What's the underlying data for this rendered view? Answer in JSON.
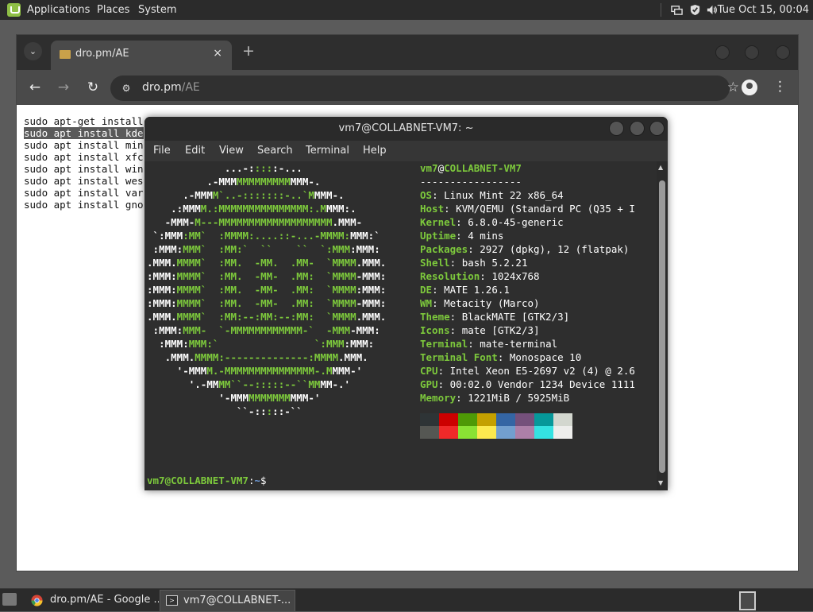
{
  "top_panel": {
    "menus": [
      "Applications",
      "Places",
      "System"
    ],
    "clock": "Tue Oct 15, 00:04",
    "tray_icons": [
      "network-icon",
      "shield-icon",
      "volume-icon"
    ]
  },
  "browser": {
    "tab": {
      "title": "dro.pm/AE",
      "close": "×",
      "new_tab": "+"
    },
    "url": {
      "host": "dro.pm",
      "path": "/AE"
    },
    "page_lines": [
      "sudo apt-get install",
      "sudo apt install kde",
      "sudo apt install min",
      "sudo apt install xfc",
      "sudo apt install win",
      "sudo apt install wes",
      "sudo apt install var",
      "sudo apt install gno"
    ],
    "highlighted_line_index": 1
  },
  "terminal": {
    "title": "vm7@COLLABNET-VM7: ~",
    "menu": [
      "File",
      "Edit",
      "View",
      "Search",
      "Terminal",
      "Help"
    ],
    "logo": [
      "             ...-:::::-...",
      "          .-MMMMMMMMMMMMMMM-.",
      "      .-MMMM`..-:::::::-..`MMMM-.",
      "    .:MMMM.:MMMMMMMMMMMMMMM:.MMMM:.",
      "   -MMM-M---MMMMMMMMMMMMMMMMMMM.MMM-",
      " `:MMM:MM`  :MMMM:....::-...-MMMM:MMM:`",
      " :MMM:MMM`  :MM:`  ``    ``  `:MMM:MMM:",
      ".MMM.MMMM`  :MM.  -MM.  .MM-  `MMMM.MMM.",
      ":MMM:MMMM`  :MM.  -MM-  .MM:  `MMMM-MMM:",
      ":MMM:MMMM`  :MM.  -MM-  .MM:  `MMMM:MMM:",
      ":MMM:MMMM`  :MM.  -MM-  .MM:  `MMMM-MMM:",
      ".MMM.MMMM`  :MM:--:MM:--:MM:  `MMMM.MMM.",
      " :MMM:MMM-  `-MMMMMMMMMMMM-`  -MMM-MMM:",
      "  :MMM:MMM:`                `:MMM:MMM:",
      "   .MMM.MMMM:--------------:MMMM.MMM.",
      "     '-MMMM.-MMMMMMMMMMMMMMM-.MMMM-'",
      "       '.-MMMM``--:::::--``MMMM-.'",
      "            '-MMMMMMMMMMMMM-'",
      "               ``-:::::-``"
    ],
    "header": {
      "user": "vm7",
      "at": "@",
      "host": "COLLABNET-VM7",
      "separator": "-----------------"
    },
    "info": [
      {
        "key": "OS",
        "value": "Linux Mint 22 x86_64"
      },
      {
        "key": "Host",
        "value": "KVM/QEMU (Standard PC (Q35 + I"
      },
      {
        "key": "Kernel",
        "value": "6.8.0-45-generic"
      },
      {
        "key": "Uptime",
        "value": "4 mins"
      },
      {
        "key": "Packages",
        "value": "2927 (dpkg), 12 (flatpak)"
      },
      {
        "key": "Shell",
        "value": "bash 5.2.21"
      },
      {
        "key": "Resolution",
        "value": "1024x768"
      },
      {
        "key": "DE",
        "value": "MATE 1.26.1"
      },
      {
        "key": "WM",
        "value": "Metacity (Marco)"
      },
      {
        "key": "Theme",
        "value": "BlackMATE [GTK2/3]"
      },
      {
        "key": "Icons",
        "value": "mate [GTK2/3]"
      },
      {
        "key": "Terminal",
        "value": "mate-terminal"
      },
      {
        "key": "Terminal Font",
        "value": "Monospace 10"
      },
      {
        "key": "CPU",
        "value": "Intel Xeon E5-2697 v2 (4) @ 2.6"
      },
      {
        "key": "GPU",
        "value": "00:02.0 Vendor 1234 Device 1111"
      },
      {
        "key": "Memory",
        "value": "1221MiB / 5925MiB"
      }
    ],
    "palette_top": [
      "#2e3436",
      "#cc0000",
      "#4e9a06",
      "#c4a000",
      "#3465a4",
      "#75507b",
      "#06989a",
      "#d3d7cf"
    ],
    "palette_bottom": [
      "#555753",
      "#ef2929",
      "#8ae234",
      "#fce94f",
      "#729fcf",
      "#ad7fa8",
      "#34e2e2",
      "#eeeeec"
    ],
    "prompt": {
      "user_host": "vm7@COLLABNET-VM7",
      "sep": ":",
      "path": "~",
      "symbol": "$"
    }
  },
  "taskbar": {
    "tasks": [
      {
        "label": "dro.pm/AE - Google ..."
      },
      {
        "label": "vm7@COLLABNET-..."
      }
    ]
  }
}
